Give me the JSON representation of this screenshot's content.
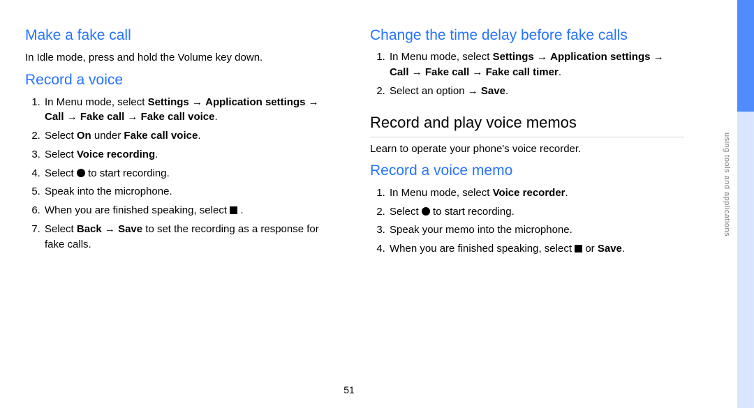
{
  "pageNumber": "51",
  "sideTabLabel": "using tools and applications",
  "left": {
    "h_make": "Make a fake call",
    "p_idle": "In Idle mode, press and hold the Volume key down.",
    "h_record": "Record a voice",
    "rv": {
      "s1a": "In Menu mode, select ",
      "s1b": "Settings",
      "s1c": "Application settings",
      "s1d": "Call",
      "s1e": "Fake call",
      "s1f": "Fake call voice",
      "s2a": "Select ",
      "s2b": "On",
      "s2c": " under ",
      "s2d": "Fake call voice",
      "s3a": "Select ",
      "s3b": "Voice recording",
      "s4a": "Select ",
      "s4b": " to start recording.",
      "s5": "Speak into the microphone.",
      "s6a": "When you are finished speaking, select ",
      "s6b": " .",
      "s7a": "Select ",
      "s7b": "Back",
      "s7c": "Save",
      "s7d": " to set the recording as a response for fake calls."
    }
  },
  "right": {
    "h_change": "Change the time delay before fake calls",
    "cd": {
      "s1a": "In Menu mode, select ",
      "s1b": "Settings",
      "s1c": "Application settings",
      "s1d": "Call",
      "s1e": "Fake call",
      "s1f": "Fake call timer",
      "s2a": "Select an option ",
      "s2b": "Save"
    },
    "h_memos": "Record and play voice memos",
    "p_learn": "Learn to operate your phone's voice recorder.",
    "h_rvm": "Record a voice memo",
    "rvm": {
      "s1a": "In Menu mode, select ",
      "s1b": "Voice recorder",
      "s2a": "Select ",
      "s2b": " to start recording.",
      "s3": "Speak your memo into the microphone.",
      "s4a": "When you are finished speaking, select ",
      "s4b": " or ",
      "s4c": "Save"
    }
  },
  "arrow": "→"
}
